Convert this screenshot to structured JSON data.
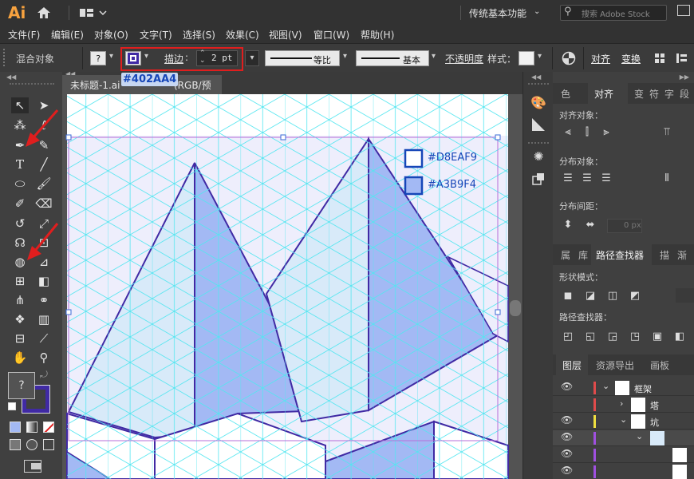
{
  "app": {
    "logo": "Ai",
    "workspace": "传统基本功能",
    "search_placeholder": "搜索 Adobe Stock"
  },
  "menu": [
    "文件(F)",
    "编辑(E)",
    "对象(O)",
    "文字(T)",
    "选择(S)",
    "效果(C)",
    "视图(V)",
    "窗口(W)",
    "帮助(H)"
  ],
  "control": {
    "selection_type": "混合对象",
    "fill_unknown": "?",
    "stroke_label": "描边",
    "stroke_weight": "2 pt",
    "stroke_color": "#402AA4",
    "profile_label": "等比",
    "brush_label": "基本",
    "opacity_label": "不透明度",
    "style_label": "样式：",
    "align_label": "对齐",
    "transform_label": "变换"
  },
  "document": {
    "tab_title": "未标题-1.ai",
    "tab_tail": "(RGB/预览)",
    "stroke_callout": "#402AA4"
  },
  "canvas": {
    "swatch1": "#D8EAF9",
    "swatch2": "#A3B9F4",
    "fill_swatch": "#D8EAF9",
    "side_fill": "#A3B9F4"
  },
  "toolpanel": {
    "unknown_fill": "?"
  },
  "align_panel": {
    "tabs": [
      "色",
      "对齐",
      "变",
      "符",
      "字",
      "段"
    ],
    "align_objects": "对齐对象：",
    "distribute_objects": "分布对象：",
    "distribute_spacing": "分布间距：",
    "spacing_value": "0 px"
  },
  "pathfinder_panel": {
    "tabs": [
      "属",
      "库",
      "路径查找器",
      "描",
      "渐"
    ],
    "shape_modes": "形状模式：",
    "pathfinders": "路径查找器："
  },
  "layers_panel": {
    "tabs": [
      "图层",
      "资源导出",
      "画板"
    ],
    "layers": [
      {
        "name": "框架",
        "color": "#e04b4b"
      },
      {
        "name": "塔",
        "color": "#e04b4b"
      },
      {
        "name": "坑",
        "color": "#f0e040"
      },
      {
        "name": "",
        "color": "#a050e0"
      },
      {
        "name": "",
        "color": "#a050e0"
      },
      {
        "name": "",
        "color": "#a050e0"
      }
    ]
  }
}
